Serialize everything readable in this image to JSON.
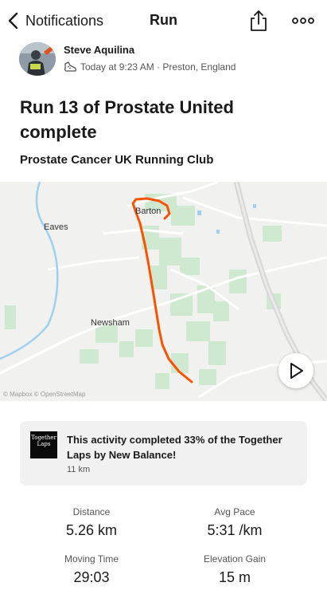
{
  "header": {
    "back_label": "Notifications",
    "title": "Run",
    "icons": {
      "back": "chevron-left-icon",
      "share": "share-icon",
      "more": "more-icon"
    }
  },
  "athlete": {
    "name": "Steve Aquilina",
    "meta": "Today at 9:23 AM · Preston, England",
    "sport_icon": "shoe-icon"
  },
  "activity": {
    "title": "Run 13 of Prostate United complete",
    "club": "Prostate Cancer UK Running Club"
  },
  "map": {
    "labels": {
      "barton": "Barton",
      "eaves": "Eaves",
      "newsham": "Newsham"
    },
    "attribution": "© Mapbox © OpenStreetMap",
    "route_color": "#fc5200"
  },
  "challenge": {
    "badge_line1": "Together",
    "badge_line2": "Laps",
    "text": "This activity completed 33% of the Together Laps by New Balance!",
    "progress": "11 km"
  },
  "stats": [
    {
      "label": "Distance",
      "value": "5.26 km"
    },
    {
      "label": "Avg Pace",
      "value": "5:31 /km"
    },
    {
      "label": "Moving Time",
      "value": "29:03"
    },
    {
      "label": "Elevation Gain",
      "value": "15 m"
    }
  ]
}
